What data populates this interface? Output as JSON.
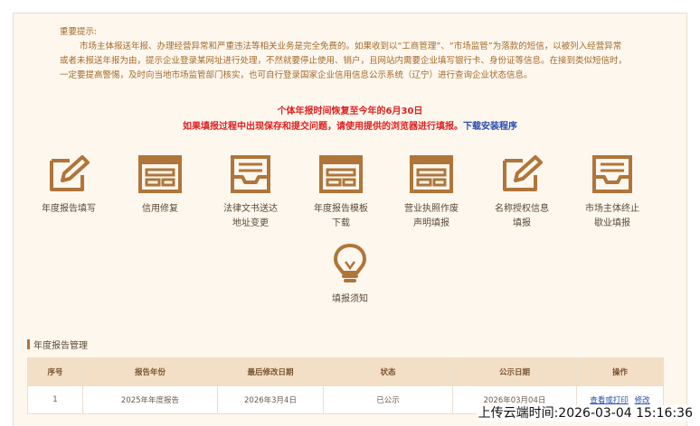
{
  "notice": {
    "head": "重要提示:",
    "body": "市场主体报送年报、办理经营异常和严重违法等相关业务是完全免费的。如果收到以“工商管理”、“市场监管”为落款的短信，以被列入经营异常或者未报送年报为由，提示企业登录某网址进行处理，不然就要停止使用、销户，且网站内需要企业填写银行卡、身份证等信息。在接到类似短信时，一定要提高警惕，及时向当地市场监管部门核实，也可自行登录国家企业信用信息公示系统（辽宁）进行查询企业状态信息。"
  },
  "alerts": {
    "line1": "个体年报时间恢复至今年的6月30日",
    "line2": "如果填报过程中出现保存和提交问题，请使用提供的浏览器进行填报。",
    "download": "下载安装程序"
  },
  "tiles": [
    {
      "label1": "年度报告填写",
      "label2": "",
      "icon": "edit-icon"
    },
    {
      "label1": "信用修复",
      "label2": "",
      "icon": "form-icon"
    },
    {
      "label1": "法律文书送达",
      "label2": "地址变更",
      "icon": "tray-icon"
    },
    {
      "label1": "年度报告模板",
      "label2": "下载",
      "icon": "form-icon"
    },
    {
      "label1": "营业执照作废",
      "label2": "声明填报",
      "icon": "form-icon"
    },
    {
      "label1": "名称授权信息",
      "label2": "填报",
      "icon": "edit-icon"
    },
    {
      "label1": "市场主体终止",
      "label2": "歇业填报",
      "icon": "tray-icon"
    },
    {
      "label1": "填报须知",
      "label2": "",
      "icon": "lightbulb-icon"
    }
  ],
  "section": {
    "title": "年度报告管理"
  },
  "table": {
    "headers": [
      "序号",
      "报告年份",
      "最后修改日期",
      "状态",
      "公示日期",
      "操作"
    ],
    "rows": [
      {
        "no": "1",
        "year": "2025年年度报告",
        "modified": "2026年3月4日",
        "status": "已公示",
        "published": "2026年03月04日",
        "op1": "查看或打印",
        "op2": "修改"
      }
    ]
  },
  "stamp": "上传云端时间:2026-03-04 15:16:36",
  "colors": {
    "icon": "#b0753a",
    "alert": "#e02020",
    "link": "#2a4db0",
    "header_bg": "#f3dfc5"
  }
}
